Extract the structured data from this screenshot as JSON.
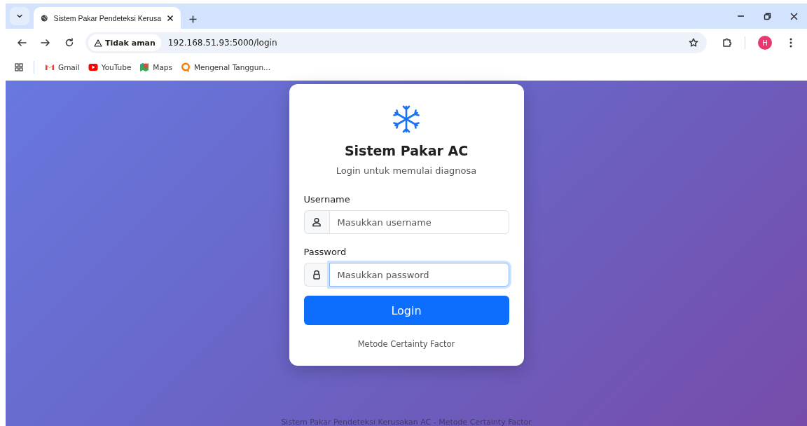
{
  "browser": {
    "tabs": [
      {
        "title": "Sistem Pakar Pendeteksi Kerusa",
        "selected": true
      }
    ],
    "address": {
      "security": "Tidak aman",
      "url": "192.168.51.93:5000/login"
    },
    "profile": "H",
    "bookmarks": [
      {
        "label": "Gmail",
        "kind": "gmail"
      },
      {
        "label": "YouTube",
        "kind": "youtube"
      },
      {
        "label": "Maps",
        "kind": "maps"
      },
      {
        "label": "Mengenal Tanggun...",
        "kind": "generic"
      }
    ]
  },
  "login": {
    "title": "Sistem Pakar AC",
    "subtitle": "Login untuk memulai diagnosa",
    "fields": [
      {
        "label": "Username",
        "placeholder": "Masukkan username",
        "kind": "user",
        "focused": false
      },
      {
        "label": "Password",
        "placeholder": "Masukkan password",
        "kind": "lock",
        "focused": true
      }
    ],
    "button": "Login",
    "method": "Metode Certainty Factor"
  },
  "footer": "Sistem Pakar Pendeteksi Kerusakan AC - Metode Certainty Factor"
}
